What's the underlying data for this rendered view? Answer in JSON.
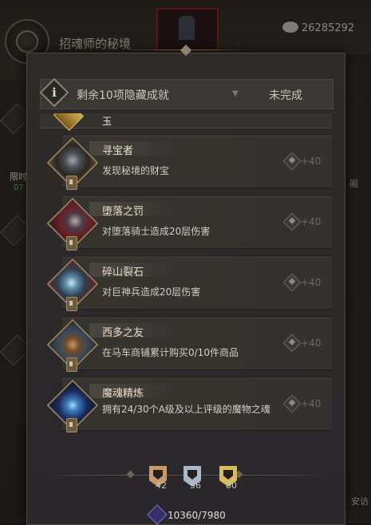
{
  "background": {
    "screen_title": "招魂师的秘境",
    "currency_value": "26285292",
    "left_side_label": "限时",
    "left_side_timer": "07",
    "right_side_label": "阁",
    "right_bottom_label": "安访"
  },
  "header": {
    "info_glyph": "i",
    "label": "剩余10项隐藏成就",
    "dropdown_arrow": "▼",
    "status": "未完成"
  },
  "list": {
    "cutoff_text": "玉",
    "achievements": [
      {
        "name": "寻宝者",
        "description": "发现秘境的财宝",
        "reward": "+40"
      },
      {
        "name": "堕落之罚",
        "description": "对堕落骑士造成20层伤害",
        "reward": "+40"
      },
      {
        "name": "碎山裂石",
        "description": "对巨神兵造成20层伤害",
        "reward": "+40"
      },
      {
        "name": "西多之友",
        "description": "在马车商铺累计购买0/10件商品",
        "reward": "+40"
      },
      {
        "name": "魔魂精炼",
        "description": "拥有24/30个A级及以上评级的魔物之魂",
        "reward": "+40"
      }
    ]
  },
  "footer": {
    "tiers": [
      {
        "count": "42",
        "color": "#c89870"
      },
      {
        "count": "56",
        "color": "#a9b9c8"
      },
      {
        "count": "80",
        "color": "#d6bc5a"
      }
    ],
    "total": "10360/7980"
  },
  "colors": {
    "panel_bg": "#2d2b28",
    "row_bg": "#36342f",
    "accent_gold": "#d6bc5a"
  }
}
